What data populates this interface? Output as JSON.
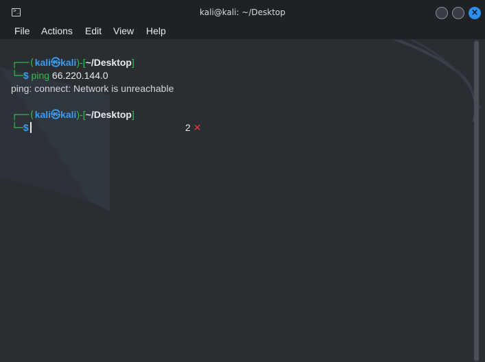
{
  "window": {
    "title": "kali@kali: ~/Desktop",
    "icon": "terminal-icon",
    "buttons": [
      "minimize-icon",
      "maximize-icon",
      "close-icon"
    ],
    "accent": "#2f8ff0"
  },
  "menu": {
    "items": [
      "File",
      "Actions",
      "Edit",
      "View",
      "Help"
    ]
  },
  "prompt": {
    "user": "kali",
    "host": "kali",
    "skull": "㉿",
    "path": "~/Desktop",
    "symbol": "$",
    "top_prefix": "┌──(",
    "bottom_prefix": "└─"
  },
  "session": {
    "command": "ping",
    "argument": "66.220.144.0",
    "output": "ping: connect: Network is unreachable",
    "exit_code": "2",
    "error_mark": "✕"
  },
  "colors": {
    "prompt_green": "#2fc24d",
    "prompt_blue": "#3a9bf0",
    "error_red": "#e03b3b",
    "background": "#2a2e33"
  }
}
